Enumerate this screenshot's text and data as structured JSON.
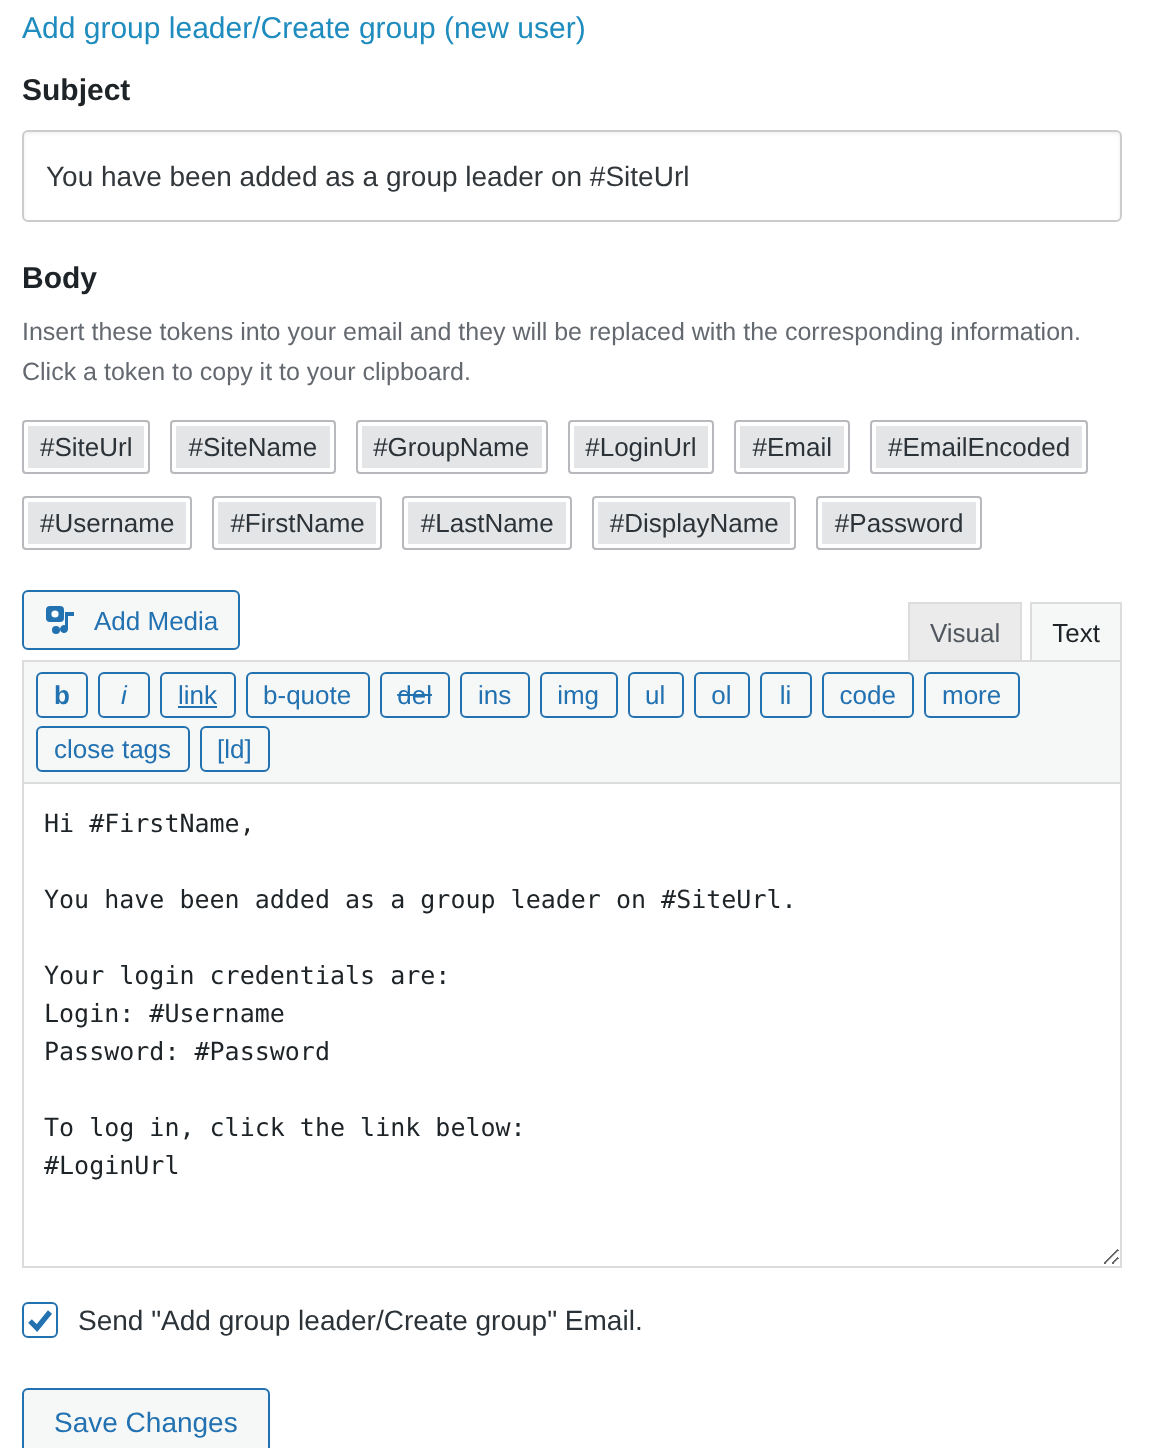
{
  "title": "Add group leader/Create group (new user)",
  "subject": {
    "label": "Subject",
    "value": "You have been added as a group leader on #SiteUrl"
  },
  "body": {
    "label": "Body",
    "description": "Insert these tokens into your email and they will be replaced with the corresponding information. Click a token to copy it to your clipboard.",
    "tokens": [
      "#SiteUrl",
      "#SiteName",
      "#GroupName",
      "#LoginUrl",
      "#Email",
      "#EmailEncoded",
      "#Username",
      "#FirstName",
      "#LastName",
      "#DisplayName",
      "#Password"
    ],
    "add_media": "Add Media",
    "tabs": [
      {
        "label": "Visual",
        "selected": false
      },
      {
        "label": "Text",
        "selected": true
      }
    ],
    "quicktags": [
      {
        "label": "b",
        "kind": "bold"
      },
      {
        "label": "i",
        "kind": "italic"
      },
      {
        "label": "link",
        "kind": "underline"
      },
      {
        "label": "b-quote",
        "kind": "plain"
      },
      {
        "label": "del",
        "kind": "strike"
      },
      {
        "label": "ins",
        "kind": "plain"
      },
      {
        "label": "img",
        "kind": "plain"
      },
      {
        "label": "ul",
        "kind": "plain"
      },
      {
        "label": "ol",
        "kind": "plain"
      },
      {
        "label": "li",
        "kind": "plain"
      },
      {
        "label": "code",
        "kind": "plain"
      },
      {
        "label": "more",
        "kind": "plain"
      },
      {
        "label": "close tags",
        "kind": "plain"
      },
      {
        "label": "[ld]",
        "kind": "plain"
      }
    ],
    "content": "Hi #FirstName,\n\nYou have been added as a group leader on #SiteUrl.\n\nYour login credentials are:\nLogin: #Username\nPassword: #Password\n\nTo log in, click the link below:\n#LoginUrl"
  },
  "send_email": {
    "label": "Send \"Add group leader/Create group\" Email.",
    "checked": true
  },
  "save_button": "Save Changes"
}
